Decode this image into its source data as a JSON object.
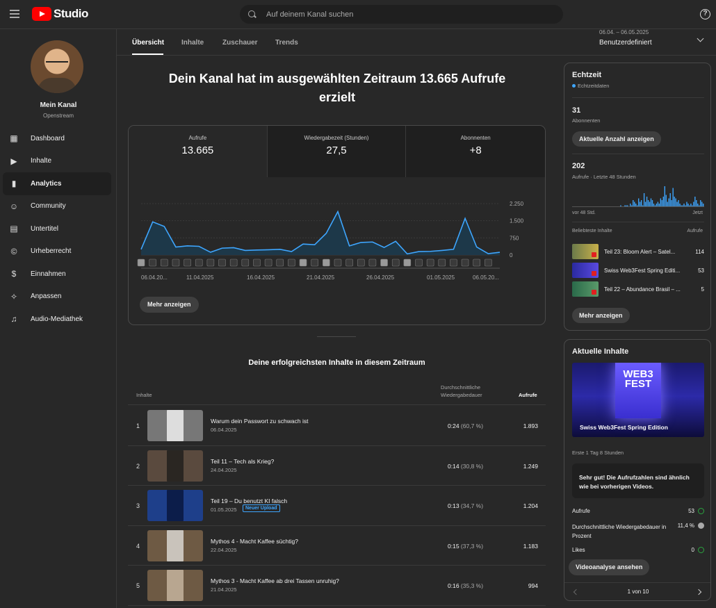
{
  "app": {
    "logo_text": "Studio"
  },
  "search": {
    "placeholder": "Auf deinem Kanal suchen"
  },
  "help": {
    "label": "?"
  },
  "sidebar": {
    "channel_name": "Mein Kanal",
    "channel_handle": "Openstream",
    "items": [
      {
        "label": "Dashboard",
        "icon": "dashboard-icon",
        "glyph": "▦"
      },
      {
        "label": "Inhalte",
        "icon": "content-icon",
        "glyph": "▶"
      },
      {
        "label": "Analytics",
        "icon": "analytics-icon",
        "glyph": "▮"
      },
      {
        "label": "Community",
        "icon": "community-icon",
        "glyph": "☺"
      },
      {
        "label": "Untertitel",
        "icon": "subtitles-icon",
        "glyph": "▤"
      },
      {
        "label": "Urheberrecht",
        "icon": "copyright-icon",
        "glyph": "©"
      },
      {
        "label": "Einnahmen",
        "icon": "earn-icon",
        "glyph": "$"
      },
      {
        "label": "Anpassen",
        "icon": "customize-icon",
        "glyph": "✧"
      },
      {
        "label": "Audio-Mediathek",
        "icon": "audio-library-icon",
        "glyph": "♫"
      }
    ]
  },
  "tabs": [
    "Übersicht",
    "Inhalte",
    "Zuschauer",
    "Trends"
  ],
  "date_range": {
    "range": "06.04. – 06.05.2025",
    "label": "Benutzerdefiniert"
  },
  "headline": "Dein Kanal hat im ausgewählten Zeitraum 13.665 Aufrufe erzielt",
  "metrics": [
    {
      "label": "Aufrufe",
      "value": "13.665"
    },
    {
      "label": "Wiedergabezeit (Stunden)",
      "value": "27,5"
    },
    {
      "label": "Abonnenten",
      "value": "+8"
    }
  ],
  "more_button": "Mehr anzeigen",
  "chart_data": {
    "type": "area",
    "y_ticks": [
      "2.250",
      "1.500",
      "750",
      "0"
    ],
    "ylim": [
      0,
      2250
    ],
    "x_labels": [
      "06.04.20...",
      "11.04.2025",
      "16.04.2025",
      "21.04.2025",
      "26.04.2025",
      "01.05.2025",
      "06.05.20..."
    ],
    "values": [
      250,
      1450,
      1250,
      350,
      400,
      380,
      120,
      300,
      320,
      200,
      220,
      230,
      250,
      150,
      480,
      450,
      950,
      1900,
      400,
      550,
      570,
      330,
      600,
      50,
      150,
      160,
      200,
      250,
      1600,
      350,
      60,
      120
    ],
    "color": "#3ea6ff"
  },
  "top_content": {
    "title": "Deine erfolgreichsten Inhalte in diesem Zeitraum",
    "col_content": "Inhalte",
    "col_duration_l1": "Durchschnittliche",
    "col_duration_l2": "Wiedergabedauer",
    "col_views": "Aufrufe",
    "rows": [
      {
        "rank": "1",
        "title": "Warum dein Passwort zu schwach ist",
        "date": "06.04.2025",
        "duration": "0:24",
        "pct": "(60,7 %)",
        "views": "1.893",
        "badge": ""
      },
      {
        "rank": "2",
        "title": "Teil 11 – Tech als Krieg?",
        "date": "24.04.2025",
        "duration": "0:14",
        "pct": "(30,8 %)",
        "views": "1.249",
        "badge": ""
      },
      {
        "rank": "3",
        "title": "Teil 19 – Du benutzt KI falsch",
        "date": "01.05.2025",
        "duration": "0:13",
        "pct": "(34,7 %)",
        "views": "1.204",
        "badge": "Neuer Upload"
      },
      {
        "rank": "4",
        "title": "Mythos 4 - Macht Kaffee süchtig?",
        "date": "22.04.2025",
        "duration": "0:15",
        "pct": "(37,3 %)",
        "views": "1.183",
        "badge": ""
      },
      {
        "rank": "5",
        "title": "Mythos 3 - Macht Kaffee ab drei Tassen unruhig?",
        "date": "21.04.2025",
        "duration": "0:16",
        "pct": "(35,3 %)",
        "views": "994",
        "badge": ""
      }
    ]
  },
  "realtime": {
    "title": "Echtzeit",
    "subtitle": "Echtzeitdaten",
    "subs_value": "31",
    "subs_label": "Abonnenten",
    "subs_button": "Aktuelle Anzahl anzeigen",
    "views_value": "202",
    "views_label": "Aufrufe · Letzte 48 Stunden",
    "axis_start": "vor 48 Std.",
    "axis_end": "Jetzt",
    "bars": [
      0,
      0,
      0,
      0,
      0,
      0,
      0,
      0,
      0,
      0,
      0,
      0,
      0,
      0,
      0,
      0,
      0,
      0,
      0,
      0,
      0,
      0,
      0,
      0,
      0,
      0,
      0,
      0,
      0,
      0,
      0,
      0,
      0,
      0,
      0,
      1,
      0,
      0,
      1,
      1,
      1,
      0,
      2,
      1,
      4,
      3,
      2,
      1,
      5,
      3,
      4,
      1,
      8,
      3,
      6,
      4,
      3,
      5,
      4,
      2,
      1,
      2,
      3,
      2,
      5,
      4,
      6,
      12,
      7,
      3,
      5,
      8,
      4,
      11,
      6,
      5,
      3,
      4,
      2,
      1,
      1,
      2,
      1,
      3,
      2,
      1,
      2,
      1,
      3,
      6,
      4,
      2,
      1,
      4,
      3,
      2
    ],
    "list_head": "Beliebteste Inhalte",
    "list_head_right": "Aufrufe",
    "items": [
      {
        "title": "Teil 23: Bloom Alert – Satel...",
        "views": "114"
      },
      {
        "title": "Swiss Web3Fest Spring Editi...",
        "views": "53"
      },
      {
        "title": "Teil 22 – Abundance Brasil – ...",
        "views": "5"
      }
    ],
    "more_button": "Mehr anzeigen"
  },
  "latest": {
    "title": "Aktuelle Inhalte",
    "sign_text": "WEB3 FEST",
    "video_title": "Swiss Web3Fest Spring Edition",
    "meta": "Erste 1 Tag 8 Stunden",
    "note": "Sehr gut! Die Aufrufzahlen sind ähnlich wie bei vorherigen Videos.",
    "stats": [
      {
        "label": "Aufrufe",
        "value": "53"
      },
      {
        "label": "Durchschnittliche Wiedergabedauer in Prozent",
        "value": "11,4 %"
      },
      {
        "label": "Likes",
        "value": "0"
      }
    ],
    "button": "Videoanalyse ansehen",
    "pager": "1 von 10"
  }
}
